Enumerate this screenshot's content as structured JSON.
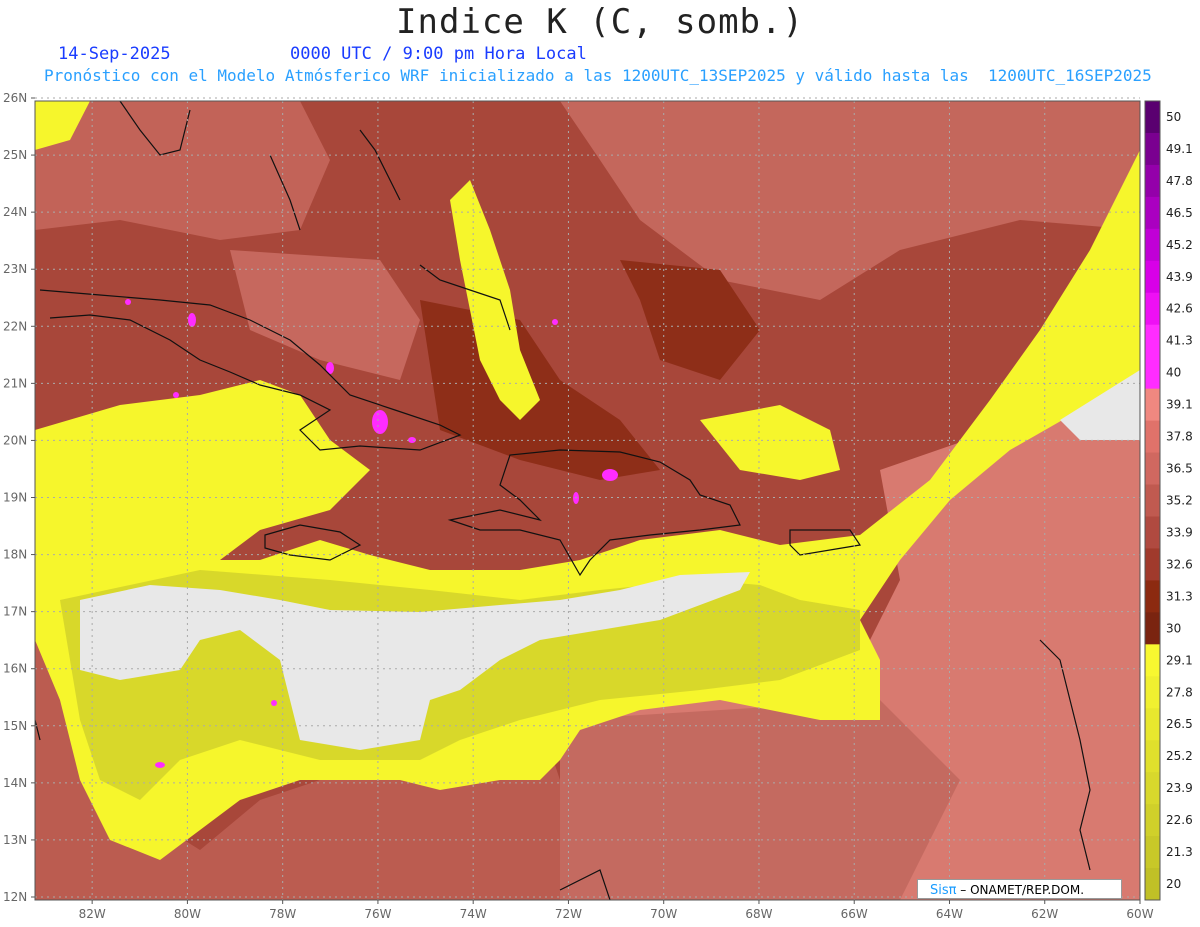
{
  "header": {
    "title": "Indice K (C, somb.)",
    "date": "14-Sep-2025",
    "time": "0000 UTC / 9:00 pm Hora Local",
    "subtitle": "Pronóstico con el Modelo Atmósferico WRF inicializado a las 1200UTC_13SEP2025 y válido hasta las  1200UTC_16SEP2025"
  },
  "map": {
    "lat_labels": [
      "26N",
      "25N",
      "24N",
      "23N",
      "22N",
      "21N",
      "20N",
      "19N",
      "18N",
      "17N",
      "16N",
      "15N",
      "14N",
      "13N",
      "12N"
    ],
    "lon_labels": [
      "82W",
      "80W",
      "78W",
      "76W",
      "74W",
      "72W",
      "70W",
      "68W",
      "66W",
      "64W",
      "62W",
      "60W"
    ],
    "lat_range": [
      12,
      26
    ],
    "lon_range": [
      -83.2,
      -60
    ],
    "grid": "dotted",
    "ocean_colors": {
      "below_20": "#e8e8e8",
      "yellow_low": "#c6c62a",
      "yellow_high": "#f8f82a",
      "red_low": "#8c2a10",
      "red_mid": "#b5564a",
      "red_high": "#e0726a",
      "magenta": "#ff2cff"
    }
  },
  "colorbar": {
    "labels": [
      "50",
      "49.1",
      "47.8",
      "46.5",
      "45.2",
      "43.9",
      "42.6",
      "41.3",
      "40",
      "39.1",
      "37.8",
      "36.5",
      "35.2",
      "33.9",
      "32.6",
      "31.3",
      "30",
      "29.1",
      "27.8",
      "26.5",
      "25.2",
      "23.9",
      "22.6",
      "21.3",
      "20"
    ],
    "colors": [
      "#5a0070",
      "#7a0090",
      "#9400aa",
      "#aa00c0",
      "#c000d6",
      "#d800e8",
      "#ee10f4",
      "#ff2cff",
      "#ff2cff",
      "#f08880",
      "#e0726a",
      "#d06860",
      "#c05a50",
      "#b04a40",
      "#a03a2c",
      "#8c2a10",
      "#7a2410",
      "#f8f830",
      "#f0f030",
      "#e8e82e",
      "#e0e02c",
      "#d8d82c",
      "#d0d02a",
      "#c8c828",
      "#c0c026"
    ],
    "bottom_color": "#e8e8e8"
  },
  "credit": {
    "logo": "Sisπ",
    "text": "– ONAMET/REP.DOM."
  }
}
